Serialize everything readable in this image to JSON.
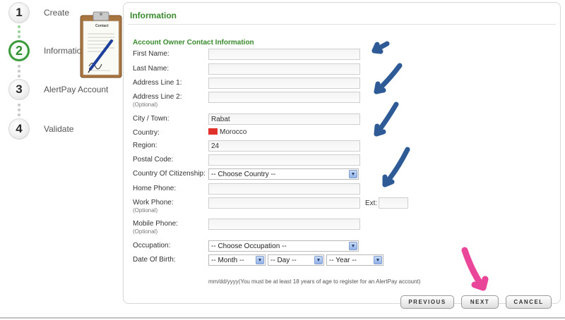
{
  "steps": [
    {
      "num": "1",
      "label": "Create"
    },
    {
      "num": "2",
      "label": "Information"
    },
    {
      "num": "3",
      "label": "AlertPay Account"
    },
    {
      "num": "4",
      "label": "Validate"
    }
  ],
  "clipboard": {
    "label": "Contact"
  },
  "panel": {
    "title": "Information",
    "section_title": "Account Owner Contact Information"
  },
  "form": {
    "first_name": {
      "label": "First Name:",
      "value": ""
    },
    "last_name": {
      "label": "Last Name:",
      "value": ""
    },
    "address1": {
      "label": "Address Line 1:",
      "value": ""
    },
    "address2": {
      "label": "Address Line 2:",
      "optional": "(Optional)",
      "value": ""
    },
    "city": {
      "label": "City / Town:",
      "value": "Rabat"
    },
    "country": {
      "label": "Country:",
      "value": "Morocco"
    },
    "region": {
      "label": "Region:",
      "value": "24"
    },
    "postal": {
      "label": "Postal Code:",
      "value": ""
    },
    "citizenship": {
      "label": "Country Of Citizenship:",
      "value": "-- Choose Country --"
    },
    "home_phone": {
      "label": "Home Phone:",
      "value": ""
    },
    "work_phone": {
      "label": "Work Phone:",
      "optional": "(Optional)",
      "value": "",
      "ext_label": "Ext:",
      "ext_value": ""
    },
    "mobile_phone": {
      "label": "Mobile Phone:",
      "optional": "(Optional)",
      "value": ""
    },
    "occupation": {
      "label": "Occupation:",
      "value": "-- Choose Occupation --"
    },
    "dob": {
      "label": "Date Of Birth:",
      "month": "-- Month --",
      "day": "-- Day --",
      "year": "-- Year --"
    },
    "dob_hint": "mm/dd/yyyy(You must be at least 18 years of age to register for an AlertPay account)"
  },
  "buttons": {
    "previous": "PREVIOUS",
    "next": "NEXT",
    "cancel": "CANCEL"
  },
  "colors": {
    "accent_green": "#3a8a2e",
    "annotation_blue": "#1f4f8f",
    "annotation_pink": "#e8338f",
    "flag_red": "#e0322b"
  },
  "icons": {
    "dropdown": "chevron-down-icon",
    "flag": "morocco-flag-icon",
    "illustration": "clipboard-icon"
  }
}
